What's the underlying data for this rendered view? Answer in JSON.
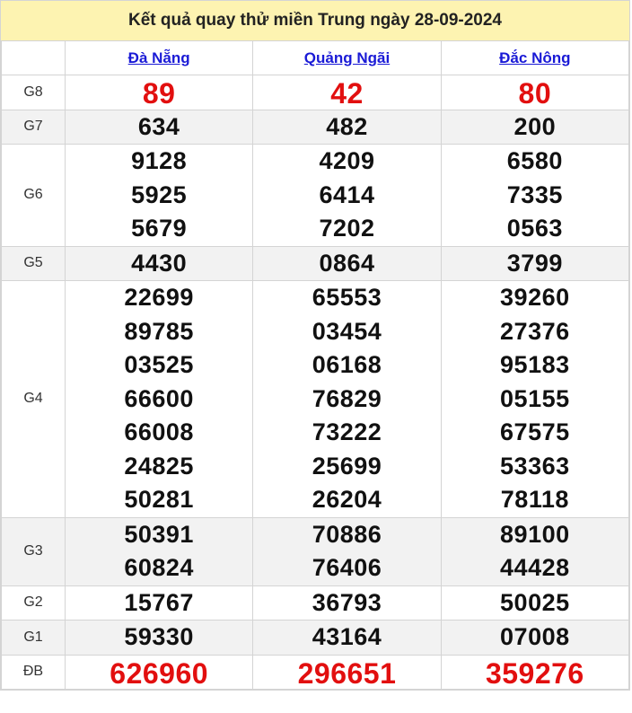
{
  "title": "Kết quả quay thử miền Trung ngày 28-09-2024",
  "provinces": [
    "Đà Nẵng",
    "Quảng Ngãi",
    "Đắc Nông"
  ],
  "prizes": [
    {
      "label": "G8",
      "values": [
        [
          "89"
        ],
        [
          "42"
        ],
        [
          "80"
        ]
      ],
      "highlight": true
    },
    {
      "label": "G7",
      "values": [
        [
          "634"
        ],
        [
          "482"
        ],
        [
          "200"
        ]
      ]
    },
    {
      "label": "G6",
      "values": [
        [
          "9128",
          "5925",
          "5679"
        ],
        [
          "4209",
          "6414",
          "7202"
        ],
        [
          "6580",
          "7335",
          "0563"
        ]
      ]
    },
    {
      "label": "G5",
      "values": [
        [
          "4430"
        ],
        [
          "0864"
        ],
        [
          "3799"
        ]
      ]
    },
    {
      "label": "G4",
      "values": [
        [
          "22699",
          "89785",
          "03525",
          "66600",
          "66008",
          "24825",
          "50281"
        ],
        [
          "65553",
          "03454",
          "06168",
          "76829",
          "73222",
          "25699",
          "26204"
        ],
        [
          "39260",
          "27376",
          "95183",
          "05155",
          "67575",
          "53363",
          "78118"
        ]
      ]
    },
    {
      "label": "G3",
      "values": [
        [
          "50391",
          "60824"
        ],
        [
          "70886",
          "76406"
        ],
        [
          "89100",
          "44428"
        ]
      ]
    },
    {
      "label": "G2",
      "values": [
        [
          "15767"
        ],
        [
          "36793"
        ],
        [
          "50025"
        ]
      ]
    },
    {
      "label": "G1",
      "values": [
        [
          "59330"
        ],
        [
          "43164"
        ],
        [
          "07008"
        ]
      ]
    },
    {
      "label": "ĐB",
      "values": [
        [
          "626960"
        ],
        [
          "296651"
        ],
        [
          "359276"
        ]
      ],
      "highlight": true
    }
  ],
  "colors": {
    "header_bg": "#fdf3b1",
    "link": "#1a1ad6",
    "highlight": "#e20f0f",
    "alt_row": "#f2f2f2"
  }
}
